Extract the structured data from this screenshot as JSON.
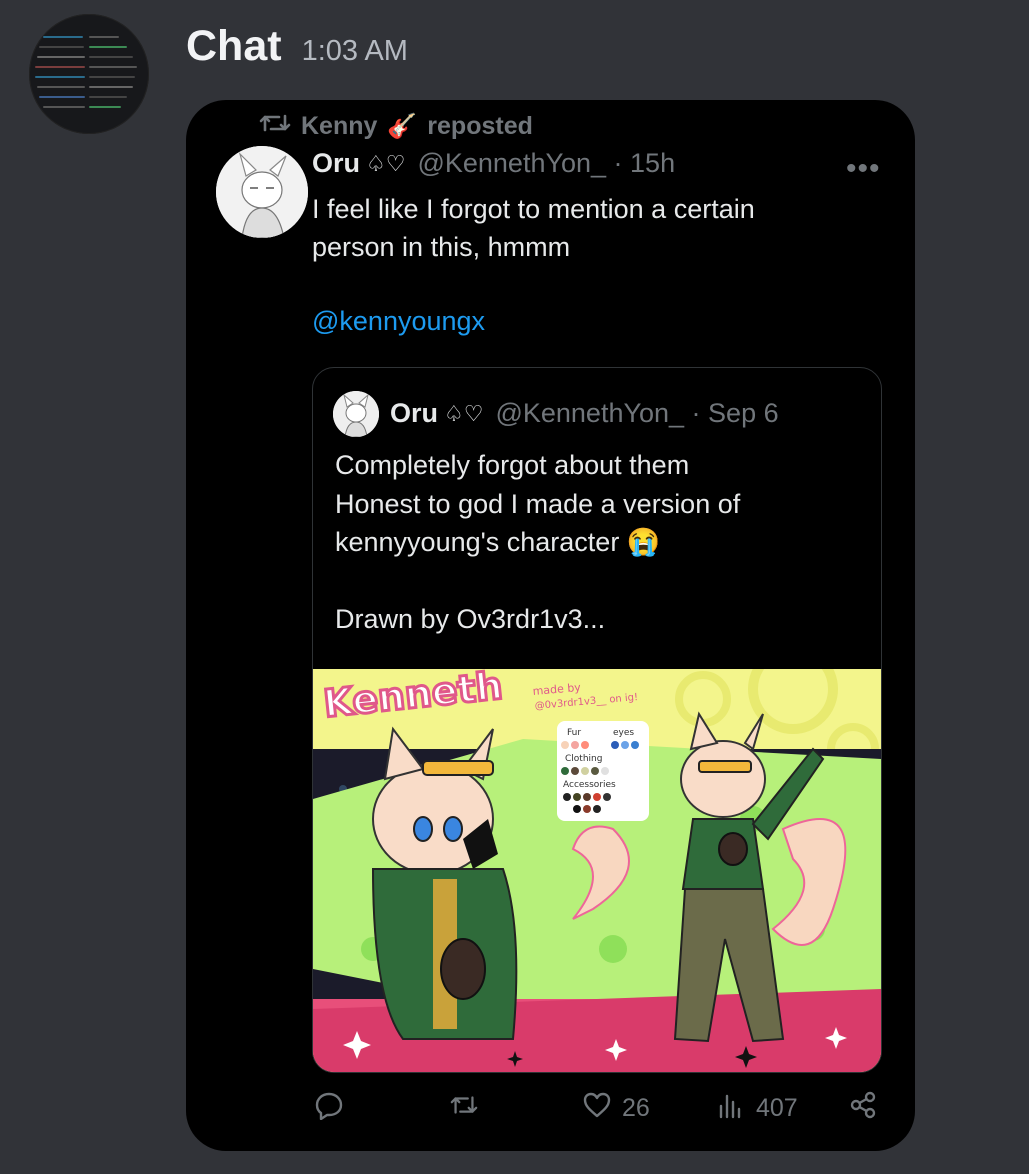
{
  "message": {
    "username": "Chat",
    "timestamp": "1:03 AM"
  },
  "tweet": {
    "repost_user": "Kenny",
    "repost_emoji": "🎸",
    "repost_label": "reposted",
    "author_name": "Oru",
    "author_suits": "♤♡",
    "author_handle": "@KennethYon_ · 15h",
    "text": "I feel like I forgot to mention a certain\nperson in this, hmmm",
    "mention": "@kennyoungx",
    "more_icon": "more-horizontal-icon",
    "quote": {
      "author_name": "Oru",
      "author_suits": "♤♡",
      "author_handle": "@KennethYon_ · Sep 6",
      "text": "Completely forgot about them\nHonest to god I made a version of\nkennyyoung's character 😭\n\nDrawn by Ov3rdr1v3...",
      "artwork": {
        "title": "Kenneth",
        "credit": "made by @0v3rdr1v3__ on ig!",
        "palette_labels": [
          "Fur",
          "eyes",
          "Clothing",
          "Accessories"
        ]
      }
    },
    "actions": {
      "reply_icon": "reply-icon",
      "repost_icon": "repost-icon",
      "likes": "26",
      "views": "407",
      "share_icon": "share-icon"
    }
  },
  "colors": {
    "background": "#313338",
    "card": "#000000",
    "mention": "#1d9bf0",
    "muted": "#71767b"
  }
}
